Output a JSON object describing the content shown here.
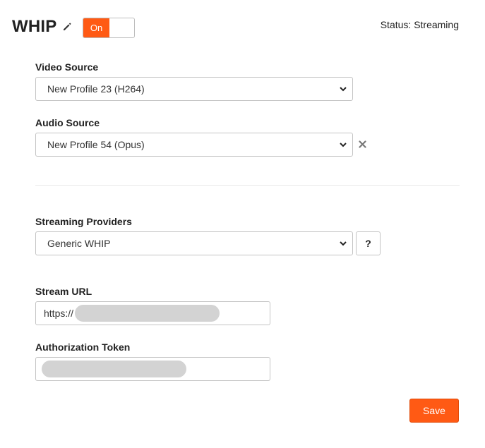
{
  "header": {
    "title": "WHIP",
    "toggle_label": "On",
    "toggle_state": "on",
    "status": "Status: Streaming",
    "accent_color": "#ff5a14"
  },
  "video_source": {
    "label": "Video Source",
    "selected": "New Profile 23 (H264)"
  },
  "audio_source": {
    "label": "Audio Source",
    "selected": "New Profile 54 (Opus)"
  },
  "streaming_providers": {
    "label": "Streaming Providers",
    "selected": "Generic WHIP",
    "help_label": "?"
  },
  "stream_url": {
    "label": "Stream URL",
    "value_prefix": "https://"
  },
  "authorization_token": {
    "label": "Authorization Token"
  },
  "actions": {
    "save_label": "Save"
  }
}
